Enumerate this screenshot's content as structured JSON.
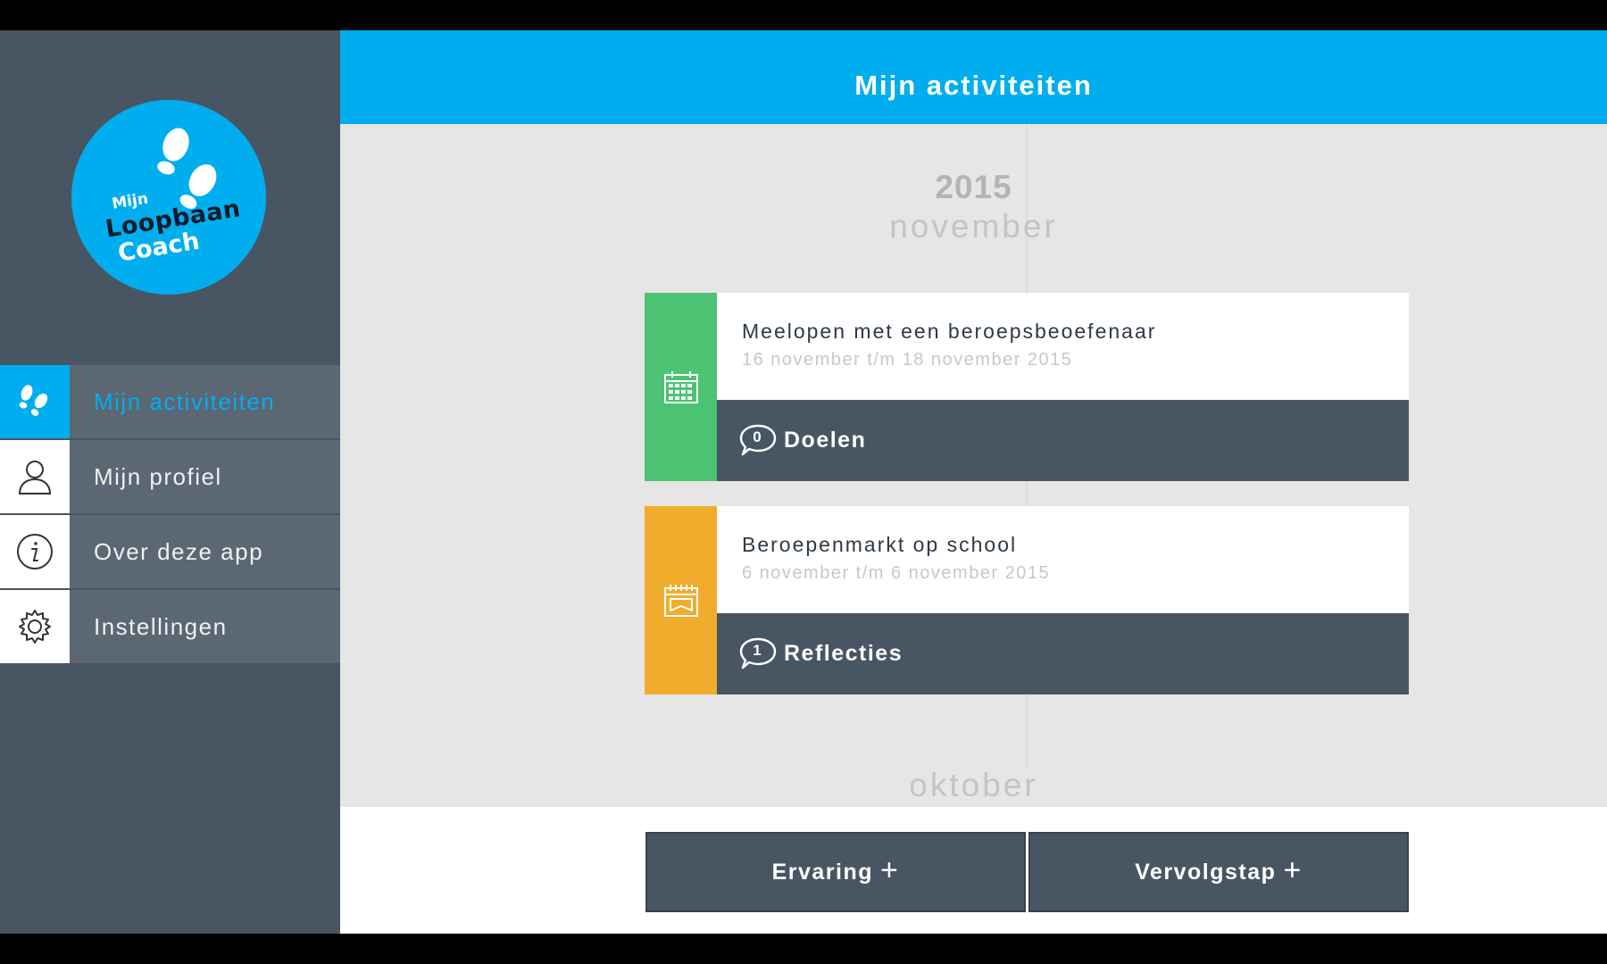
{
  "app": {
    "logo": {
      "line1": "Mijn",
      "line2": "Loopbaan",
      "line3": "Coach"
    }
  },
  "sidebar": {
    "items": [
      {
        "label": "Mijn activiteiten",
        "icon": "footprints-icon",
        "active": true
      },
      {
        "label": "Mijn profiel",
        "icon": "user-icon",
        "active": false
      },
      {
        "label": "Over deze app",
        "icon": "info-icon",
        "active": false
      },
      {
        "label": "Instellingen",
        "icon": "gear-icon",
        "active": false
      }
    ]
  },
  "header": {
    "title": "Mijn activiteiten"
  },
  "timeline": {
    "year": "2015",
    "month_current": "november",
    "month_next": "oktober"
  },
  "cards": [
    {
      "title": "Meelopen met een beroepsbeoefenaar",
      "date": "16 november t/m 18 november 2015",
      "icon": "calendar-icon",
      "strip_color": "#4cc373",
      "count": "0",
      "action": "Doelen"
    },
    {
      "title": "Beroepenmarkt op school",
      "date": "6 november t/m 6 november 2015",
      "icon": "event-calendar-icon",
      "strip_color": "#f2ac2d",
      "count": "1",
      "action": "Reflecties"
    }
  ],
  "actions": {
    "experience": "Ervaring",
    "next_step": "Vervolgstap",
    "plus": "+"
  },
  "colors": {
    "accent": "#00aeef",
    "sidebar": "#485563",
    "green": "#4cc373",
    "orange": "#f2ac2d"
  }
}
